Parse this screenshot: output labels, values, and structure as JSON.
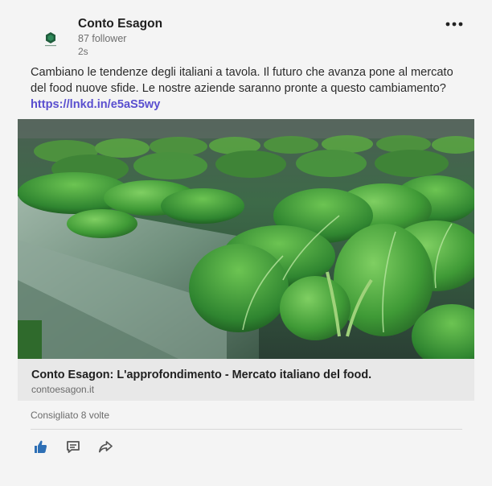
{
  "post": {
    "author": {
      "name": "Conto Esagon",
      "followers": "87 follower",
      "time_ago": "2s",
      "avatar_icon": "hexagon-logo-icon"
    },
    "more_icon": "more-horizontal-icon",
    "text_before_link": "Cambiano le tendenze degli italiani a tavola. Il futuro che avanza pone al mercato del food nuove sfide. Le nostre aziende saranno pronte a questo cambiamento? ",
    "link_text": "https://lnkd.in/e5aS5wy",
    "link_color": "#5a4fcf",
    "image_icon": "lettuce-hydroponic-image",
    "preview": {
      "title": "Conto Esagon: L'approfondimento - Mercato italiano del food.",
      "domain": "contoesagon.it"
    },
    "social_counts": "Consigliato 8 volte",
    "actions": [
      {
        "name": "like",
        "icon": "thumbs-up-icon",
        "color": "#2d6fb5"
      },
      {
        "name": "comment",
        "icon": "comment-icon",
        "color": "#555555"
      },
      {
        "name": "share",
        "icon": "share-icon",
        "color": "#555555"
      }
    ]
  }
}
